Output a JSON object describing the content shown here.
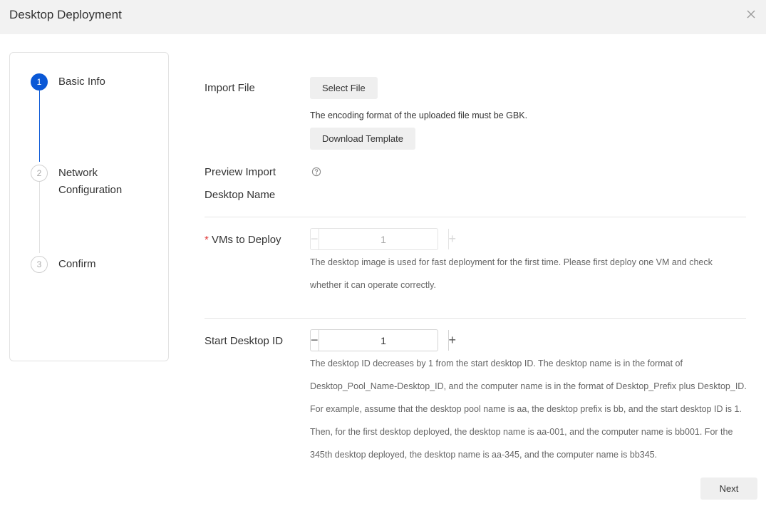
{
  "dialog": {
    "title": "Desktop Deployment"
  },
  "steps": [
    {
      "number": "1",
      "label": "Basic Info",
      "state": "active"
    },
    {
      "number": "2",
      "label": "Network Configuration",
      "state": "pending"
    },
    {
      "number": "3",
      "label": "Confirm",
      "state": "pending"
    }
  ],
  "import_file": {
    "label": "Import File",
    "select_button": "Select File",
    "encoding_hint": "The encoding format of the uploaded file must be GBK.",
    "download_button": "Download Template"
  },
  "preview": {
    "label_line1": "Preview Import",
    "label_line2": "Desktop Name",
    "icon": "info-circle-icon"
  },
  "vms_to_deploy": {
    "required_mark": "*",
    "label": "VMs to Deploy",
    "value": "1",
    "disabled": true,
    "description": "The desktop image is used for fast deployment for the first time. Please first deploy one VM and check whether it can operate correctly."
  },
  "start_desktop_id": {
    "label": "Start Desktop ID",
    "value": "1",
    "disabled": false,
    "description": "The desktop ID decreases by 1 from the start desktop ID. The desktop name is in the format of Desktop_Pool_Name-Desktop_ID, and the computer name is in the format of Desktop_Prefix plus Desktop_ID. For example, assume that the desktop pool name is aa, the desktop prefix is bb, and the start desktop ID is 1. Then, for the first desktop deployed, the desktop name is aa-001, and the computer name is bb001. For the 345th desktop deployed, the desktop name is aa-345, and the computer name is bb345."
  },
  "footer": {
    "next_button": "Next"
  },
  "colors": {
    "accent": "#0a58d6",
    "required": "#e03a3a",
    "title_bar": "#f2f2f2"
  }
}
